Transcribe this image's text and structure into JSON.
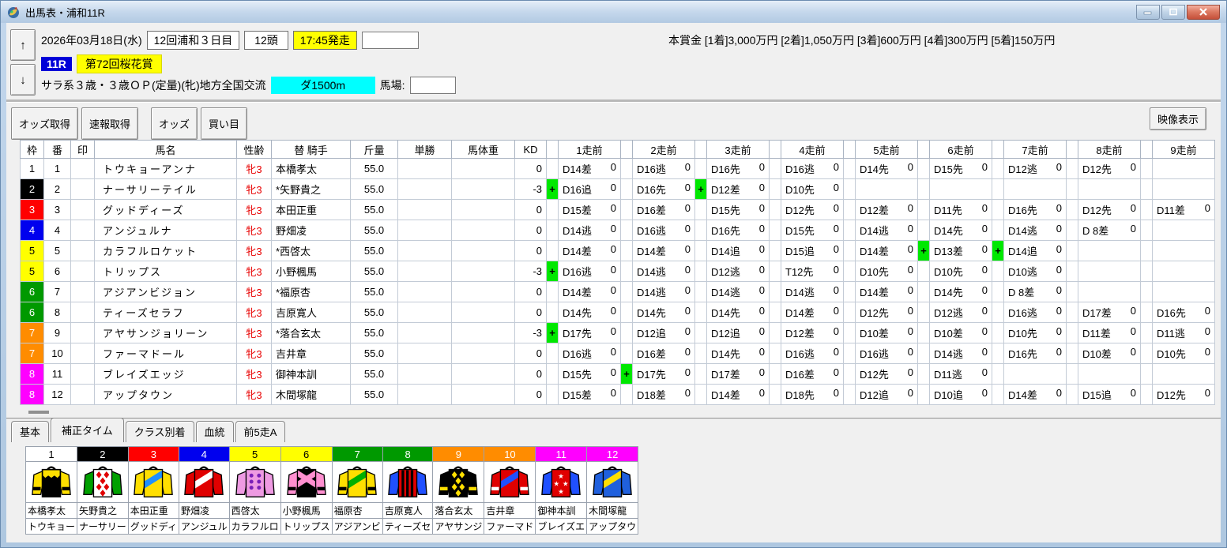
{
  "window": {
    "title": "出馬表・浦和11R"
  },
  "header": {
    "up_arrow": "↑",
    "down_arrow": "↓",
    "date": "2026年03月18日(水)",
    "meeting": "12回浦和３日目",
    "head_count": "12頭",
    "start_time": "17:45発走",
    "prize": "本賞金 [1着]3,000万円 [2着]1,050万円 [3着]600万円 [4着]300万円 [5着]150万円",
    "race_no": "11R",
    "race_name": "第72回桜花賞",
    "race_condition": "サラ系３歳・３歳ＯＰ(定量)(牝)地方全国交流",
    "distance": "ダ1500m",
    "baba_label": "馬場:"
  },
  "toolbar": {
    "buttons": [
      "オッズ取得",
      "速報取得",
      "オッズ",
      "買い目"
    ],
    "video_button": "映像表示"
  },
  "grid": {
    "columns": [
      "枠",
      "番",
      "印",
      "馬名",
      "性齢",
      "替 騎手",
      "斤量",
      "単勝",
      "馬体重",
      "KD"
    ],
    "run_columns": [
      "1走前",
      "2走前",
      "3走前",
      "4走前",
      "5走前",
      "6走前",
      "7走前",
      "8走前",
      "9走前"
    ],
    "run_result": "0",
    "waku_colors": {
      "1": {
        "bg": "#ffffff",
        "fg": "#000000"
      },
      "2": {
        "bg": "#000000",
        "fg": "#ffffff"
      },
      "3": {
        "bg": "#ff0000",
        "fg": "#ffffff"
      },
      "4": {
        "bg": "#0000ee",
        "fg": "#ffffff"
      },
      "5": {
        "bg": "#ffff00",
        "fg": "#000000"
      },
      "6": {
        "bg": "#009900",
        "fg": "#ffffff"
      },
      "7": {
        "bg": "#ff8c00",
        "fg": "#ffffff"
      },
      "8": {
        "bg": "#ff00ff",
        "fg": "#ffffff"
      }
    },
    "horses": [
      {
        "waku": 1,
        "num": 1,
        "mark": "",
        "name": "トウキョーアンナ",
        "sexage": "牝3",
        "jockey": "本橋孝太",
        "weight": "55.0",
        "win_odds": "",
        "body_weight": "",
        "kd": "0",
        "runs": [
          "D14差",
          "D16逃",
          "D16先",
          "D16逃",
          "D14先",
          "D15先",
          "D12逃",
          "D12先",
          ""
        ]
      },
      {
        "waku": 2,
        "num": 2,
        "mark": "",
        "name": "ナーサリーテイル",
        "sexage": "牝3",
        "jockey": "*矢野貴之",
        "weight": "55.0",
        "win_odds": "",
        "body_weight": "",
        "kd": "-3",
        "runs": [
          "+D16追",
          "D16先",
          "+D12差",
          "D10先",
          "",
          "",
          "",
          "",
          ""
        ]
      },
      {
        "waku": 3,
        "num": 3,
        "mark": "",
        "name": "グッドディーズ",
        "sexage": "牝3",
        "jockey": "本田正重",
        "weight": "55.0",
        "win_odds": "",
        "body_weight": "",
        "kd": "0",
        "runs": [
          "D15差",
          "D16差",
          "D15先",
          "D12先",
          "D12差",
          "D11先",
          "D16先",
          "D12先",
          "D11差"
        ]
      },
      {
        "waku": 4,
        "num": 4,
        "mark": "",
        "name": "アンジュルナ",
        "sexage": "牝3",
        "jockey": "野畑凌",
        "weight": "55.0",
        "win_odds": "",
        "body_weight": "",
        "kd": "0",
        "runs": [
          "D14逃",
          "D16逃",
          "D16先",
          "D15先",
          "D14逃",
          "D14先",
          "D14逃",
          "D 8差",
          ""
        ]
      },
      {
        "waku": 5,
        "num": 5,
        "mark": "",
        "name": "カラフルロケット",
        "sexage": "牝3",
        "jockey": "*西啓太",
        "weight": "55.0",
        "win_odds": "",
        "body_weight": "",
        "kd": "0",
        "runs": [
          "D14差",
          "D14差",
          "D14追",
          "D15追",
          "D14差",
          "+D13差",
          "+D14追",
          "",
          ""
        ]
      },
      {
        "waku": 5,
        "num": 6,
        "mark": "",
        "name": "トリップス",
        "sexage": "牝3",
        "jockey": "小野楓馬",
        "weight": "55.0",
        "win_odds": "",
        "body_weight": "",
        "kd": "-3",
        "runs": [
          "+D16逃",
          "D14逃",
          "D12逃",
          "T12先",
          "D10先",
          "D10先",
          "D10逃",
          "",
          ""
        ]
      },
      {
        "waku": 6,
        "num": 7,
        "mark": "",
        "name": "アジアンビジョン",
        "sexage": "牝3",
        "jockey": "*福原杏",
        "weight": "55.0",
        "win_odds": "",
        "body_weight": "",
        "kd": "0",
        "runs": [
          "D14差",
          "D14逃",
          "D14逃",
          "D14逃",
          "D14差",
          "D14先",
          "D 8差",
          "",
          ""
        ]
      },
      {
        "waku": 6,
        "num": 8,
        "mark": "",
        "name": "ティーズセラフ",
        "sexage": "牝3",
        "jockey": "吉原寛人",
        "weight": "55.0",
        "win_odds": "",
        "body_weight": "",
        "kd": "0",
        "runs": [
          "D14先",
          "D14先",
          "D14先",
          "D14差",
          "D12先",
          "D12逃",
          "D16逃",
          "D17差",
          "D16先"
        ]
      },
      {
        "waku": 7,
        "num": 9,
        "mark": "",
        "name": "アヤサンジョリーン",
        "sexage": "牝3",
        "jockey": "*落合玄太",
        "weight": "55.0",
        "win_odds": "",
        "body_weight": "",
        "kd": "-3",
        "runs": [
          "+D17先",
          "D12追",
          "D12追",
          "D12差",
          "D10差",
          "D10差",
          "D10先",
          "D11差",
          "D11逃"
        ]
      },
      {
        "waku": 7,
        "num": 10,
        "mark": "",
        "name": "ファーマドール",
        "sexage": "牝3",
        "jockey": "吉井章",
        "weight": "55.0",
        "win_odds": "",
        "body_weight": "",
        "kd": "0",
        "runs": [
          "D16逃",
          "D16差",
          "D14先",
          "D16逃",
          "D16逃",
          "D14逃",
          "D16先",
          "D10差",
          "D10先"
        ]
      },
      {
        "waku": 8,
        "num": 11,
        "mark": "",
        "name": "ブレイズエッジ",
        "sexage": "牝3",
        "jockey": "御神本訓",
        "weight": "55.0",
        "win_odds": "",
        "body_weight": "",
        "kd": "0",
        "runs": [
          "D15先",
          "+D17先",
          "D17差",
          "D16差",
          "D12先",
          "D11逃",
          "",
          "",
          ""
        ]
      },
      {
        "waku": 8,
        "num": 12,
        "mark": "",
        "name": "アップタウン",
        "sexage": "牝3",
        "jockey": "木間塚龍",
        "weight": "55.0",
        "win_odds": "",
        "body_weight": "",
        "kd": "0",
        "runs": [
          "D15差",
          "D18差",
          "D14差",
          "D18先",
          "D12追",
          "D10追",
          "D14差",
          "D15追",
          "D12先"
        ]
      }
    ]
  },
  "tabs": {
    "items": [
      "基本",
      "補正タイム",
      "クラス別着",
      "血統",
      "前5走A"
    ],
    "active": "補正タイム"
  },
  "silks": {
    "horses": [
      {
        "num": 1,
        "waku": 1,
        "jockey": "本橋孝太",
        "horse": "トウキョー",
        "silk": {
          "body": "#000000",
          "sleeves": "#ffdf00",
          "pattern": "yoke",
          "pcolor": "#ffdf00",
          "band": "#000000"
        }
      },
      {
        "num": 2,
        "waku": 2,
        "jockey": "矢野貴之",
        "horse": "ナーサリー",
        "silk": {
          "body": "#ffffff",
          "sleeves": "#00a000",
          "pattern": "diamonds",
          "pcolor": "#e00000",
          "band": ""
        }
      },
      {
        "num": 3,
        "waku": 3,
        "jockey": "本田正重",
        "horse": "グッドディ",
        "silk": {
          "body": "#ffdf00",
          "sleeves": "#ffdf00",
          "pattern": "sash",
          "pcolor": "#1e90ff",
          "band": ""
        }
      },
      {
        "num": 4,
        "waku": 4,
        "jockey": "野畑凌",
        "horse": "アンジュル",
        "silk": {
          "body": "#e00000",
          "sleeves": "#e00000",
          "pattern": "sash",
          "pcolor": "#ffffff",
          "band": ""
        }
      },
      {
        "num": 5,
        "waku": 5,
        "jockey": "西啓太",
        "horse": "カラフルロ",
        "silk": {
          "body": "#ee9ae2",
          "sleeves": "#ee9ae2",
          "pattern": "dots",
          "pcolor": "#7a1fb8",
          "band": ""
        }
      },
      {
        "num": 6,
        "waku": 5,
        "jockey": "小野楓馬",
        "horse": "トリップス",
        "silk": {
          "body": "#000000",
          "sleeves": "#ff8fd0",
          "pattern": "cross",
          "pcolor": "#ff8fd0",
          "band": "#000000"
        }
      },
      {
        "num": 7,
        "waku": 6,
        "jockey": "福原杏",
        "horse": "アジアンビ",
        "silk": {
          "body": "#ffdf00",
          "sleeves": "#ffdf00",
          "pattern": "sash",
          "pcolor": "#00b000",
          "band": "#000000"
        }
      },
      {
        "num": 8,
        "waku": 6,
        "jockey": "吉原寛人",
        "horse": "ティーズセ",
        "silk": {
          "body": "#e00000",
          "sleeves": "#2050ff",
          "pattern": "stripes",
          "pcolor": "#000000",
          "band": ""
        }
      },
      {
        "num": 9,
        "waku": 7,
        "jockey": "落合玄太",
        "horse": "アヤサンジ",
        "silk": {
          "body": "#000000",
          "sleeves": "#000000",
          "pattern": "diamonds",
          "pcolor": "#ffdf00",
          "band": "#ffdf00"
        }
      },
      {
        "num": 10,
        "waku": 7,
        "jockey": "吉井章",
        "horse": "ファーマド",
        "silk": {
          "body": "#e00000",
          "sleeves": "#e00000",
          "pattern": "sash",
          "pcolor": "#2050ff",
          "band": "#ffffff"
        }
      },
      {
        "num": 11,
        "waku": 8,
        "jockey": "御神本訓",
        "horse": "ブレイズエ",
        "silk": {
          "body": "#e00000",
          "sleeves": "#2050ff",
          "pattern": "stars",
          "pcolor": "#ffffff",
          "band": ""
        }
      },
      {
        "num": 12,
        "waku": 8,
        "jockey": "木間塚龍",
        "horse": "アップタウ",
        "silk": {
          "body": "#2060dd",
          "sleeves": "#2060dd",
          "pattern": "sash",
          "pcolor": "#ffdf00",
          "band": ""
        }
      }
    ]
  }
}
